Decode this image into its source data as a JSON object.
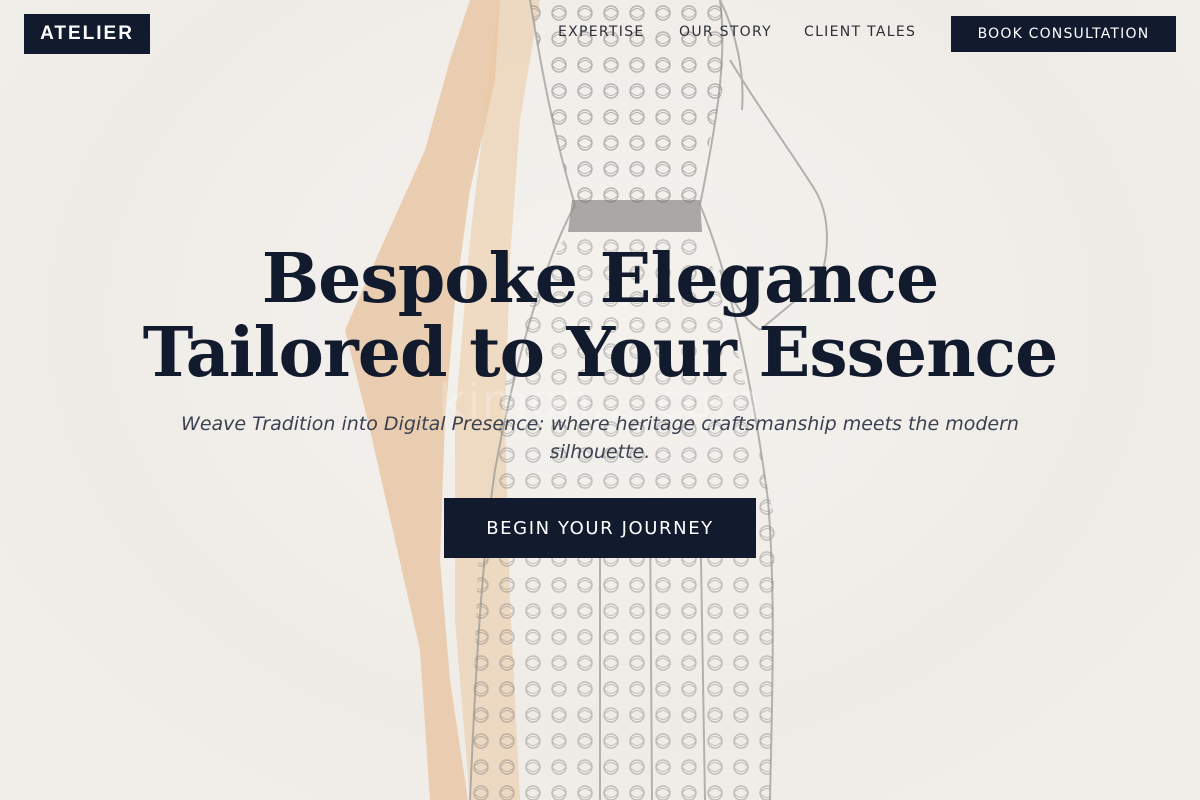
{
  "header": {
    "brand": "ATELIER",
    "nav": [
      {
        "label": "EXPERTISE"
      },
      {
        "label": "OUR STORY"
      },
      {
        "label": "CLIENT TALES"
      }
    ],
    "cta_label": "BOOK CONSULTATION"
  },
  "hero": {
    "headline_line1": "Bespoke Elegance",
    "headline_line2": "Tailored to Your Essence",
    "subheadline": "Weave Tradition into Digital Presence: where heritage craftsmanship meets the modern silhouette.",
    "cta_label": "BEGIN YOUR JOURNEY",
    "watermark_text": "kimon....com"
  },
  "colors": {
    "navy": "#121a2e",
    "background": "#f2f0ec",
    "wash_accent": "#e3ad77"
  }
}
